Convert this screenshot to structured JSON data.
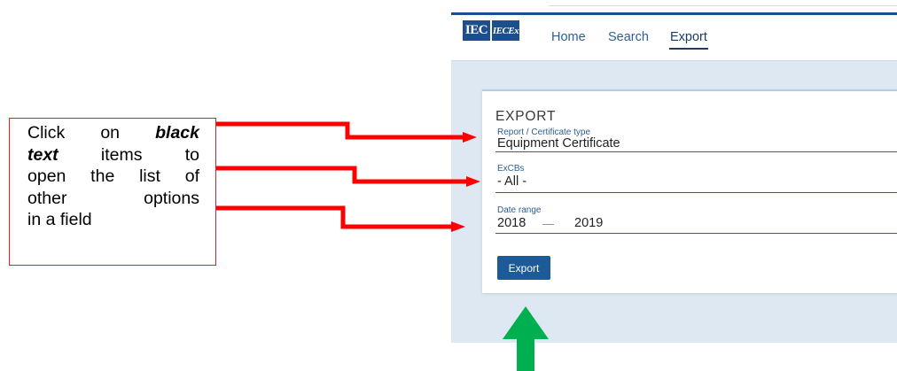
{
  "callout": {
    "lines": [
      {
        "pre": "Click on ",
        "bold": "black",
        "post": ""
      },
      {
        "pre": "",
        "bold": "text",
        "post": " items to"
      },
      {
        "pre": "open the list of",
        "bold": "",
        "post": ""
      },
      {
        "pre": "other    options",
        "bold": "",
        "post": ""
      },
      {
        "pre": "in a field",
        "bold": "",
        "post": ""
      }
    ]
  },
  "logo": {
    "iec": "IEC",
    "iecex": "IECEx"
  },
  "nav": {
    "home": "Home",
    "search": "Search",
    "export": "Export"
  },
  "form": {
    "title": "EXPORT",
    "report_type": {
      "label": "Report / Certificate type",
      "value": "Equipment Certificate"
    },
    "excbs": {
      "label": "ExCBs",
      "value": "- All -"
    },
    "date_range": {
      "label": "Date range",
      "from": "2018",
      "separator": "—",
      "to": "2019"
    },
    "export_button": "Export"
  },
  "colors": {
    "callout_border": "#e02020",
    "red_arrow": "#ff0000",
    "green_arrow": "#00b050",
    "brand_blue": "#1c4f8c",
    "page_bg": "#dde8f2"
  }
}
